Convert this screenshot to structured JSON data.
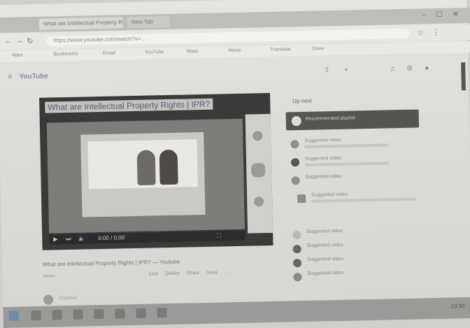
{
  "browser": {
    "tabs": [
      "What are Intellectual Property Rights | IPR ...",
      "New Tab"
    ],
    "url": "https://www.youtube.com/watch?v=...",
    "bookmarks": [
      "Apps",
      "Bookmarks",
      "Gmail",
      "YouTube",
      "Maps",
      "News",
      "Translate",
      "Drive"
    ]
  },
  "youtube": {
    "logo": "YouTube",
    "video_title": "What are Intellectual Property Rights | IPR?",
    "video_caption": "What are Intellectual Property Rights | IPR? — Youtube",
    "views": "views",
    "actions": [
      "Like",
      "Dislike",
      "Share",
      "Save",
      "..."
    ],
    "channel": "Channel",
    "up_next": "Up next",
    "banner": "Recommended playlist",
    "suggestions": [
      "Suggested video",
      "Suggested video",
      "Suggested video",
      "Suggested video",
      "Suggested video",
      "Suggested video",
      "Suggested video",
      "Suggested video"
    ],
    "controls": {
      "time": "0:00 / 0:00"
    }
  },
  "taskbar": {
    "clock": "10:30"
  }
}
